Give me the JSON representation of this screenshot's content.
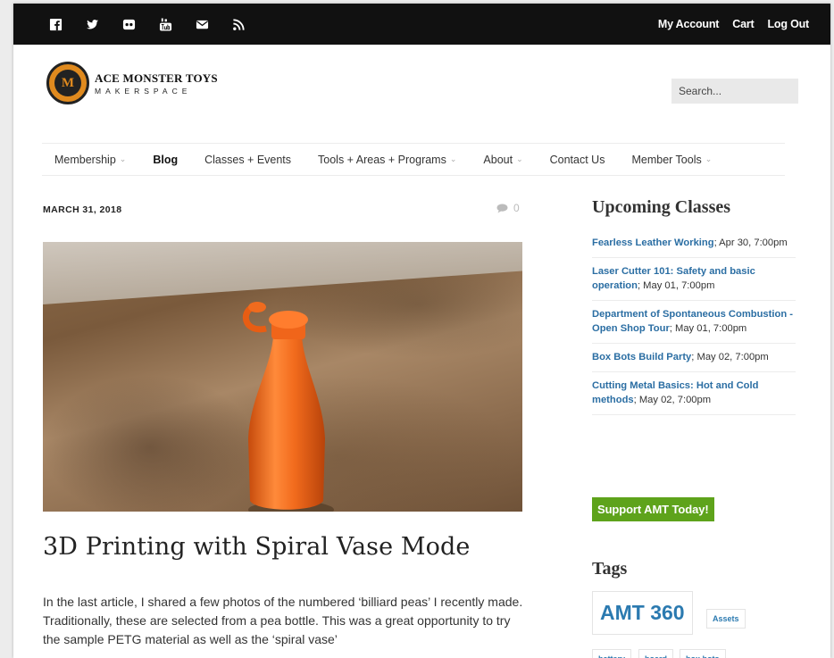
{
  "topbar": {
    "social_icons": [
      "facebook-icon",
      "twitter-icon",
      "flickr-icon",
      "youtube-icon",
      "email-icon",
      "rss-icon"
    ],
    "account_links": [
      "My Account",
      "Cart",
      "Log Out"
    ]
  },
  "header": {
    "logo_line1": "ACE MONSTER TOYS",
    "logo_line2": "MAKERSPACE",
    "logo_letter": "M",
    "search_placeholder": "Search..."
  },
  "nav": [
    {
      "label": "Membership",
      "dropdown": true,
      "active": false
    },
    {
      "label": "Blog",
      "dropdown": false,
      "active": true
    },
    {
      "label": "Classes + Events",
      "dropdown": false,
      "active": false
    },
    {
      "label": "Tools + Areas + Programs",
      "dropdown": true,
      "active": false
    },
    {
      "label": "About",
      "dropdown": true,
      "active": false
    },
    {
      "label": "Contact Us",
      "dropdown": false,
      "active": false
    },
    {
      "label": "Member Tools",
      "dropdown": true,
      "active": false
    }
  ],
  "post": {
    "date": "MARCH 31, 2018",
    "comment_count": "0",
    "title": "3D Printing with Spiral Vase Mode",
    "body": "In the last article, I shared a few photos of the numbered ‘billiard peas’ I recently made. Traditionally, these are selected from a pea bottle. This was a great opportunity to try the sample PETG material as well as the ‘spiral vase’"
  },
  "sidebar": {
    "upcoming_title": "Upcoming Classes",
    "events": [
      {
        "name": "Fearless Leather Working",
        "when": "; Apr 30, 7:00pm"
      },
      {
        "name": "Laser Cutter 101: Safety and basic operation",
        "when": "; May 01, 7:00pm"
      },
      {
        "name": "Department of Spontaneous Combustion - Open Shop Tour",
        "when": "; May 01, 7:00pm"
      },
      {
        "name": "Box Bots Build Party",
        "when": "; May 02, 7:00pm"
      },
      {
        "name": "Cutting Metal Basics: Hot and Cold methods",
        "when": "; May 02, 7:00pm"
      }
    ],
    "support_label": "Support AMT Today!",
    "tags_title": "Tags",
    "tags": [
      "AMT 360",
      "Assets",
      "battery",
      "board",
      "box bots"
    ]
  },
  "colors": {
    "topbar_bg": "#111111",
    "link_blue": "#2b6ea3",
    "support_green": "#5ea31b",
    "bottle_orange": "#f26b1d",
    "logo_orange": "#e08a1e"
  }
}
